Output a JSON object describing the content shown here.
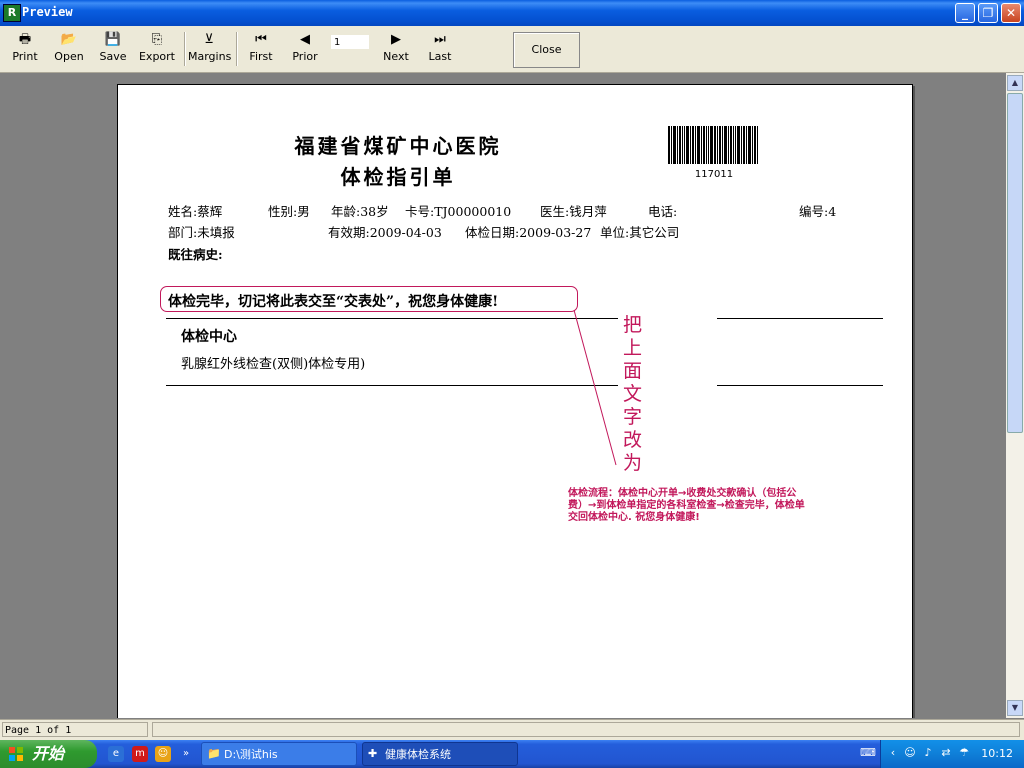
{
  "window": {
    "title": "Preview",
    "app_icon_glyph": "R",
    "buttons": {
      "minimize": "_",
      "maximize": "❐",
      "close": "✕"
    }
  },
  "toolbar": {
    "print": "Print",
    "open": "Open",
    "save": "Save",
    "export": "Export",
    "margins": "Margins",
    "first": "First",
    "prior": "Prior",
    "page_value": "1",
    "next": "Next",
    "last": "Last",
    "close": "Close"
  },
  "document": {
    "hospital": "福建省煤矿中心医院",
    "form_title": "体检指引单",
    "barcode_number": "117011",
    "line1": {
      "name": "姓名:蔡辉",
      "gender": "性别:男",
      "age": "年龄:38岁",
      "card": "卡号:TJ00000010",
      "doctor": "医生:钱月萍",
      "phone": "电话:",
      "number": "编号:4"
    },
    "line2": {
      "dept": "部门:未填报",
      "valid": "有效期:2009-04-03",
      "exam_date": "体检日期:2009-03-27",
      "unit": "单位:其它公司"
    },
    "history_label": "既往病史:",
    "note": "体检完毕，切记将此表交至“交表处”，祝您身体健康!",
    "section_title": "体检中心",
    "section_item": "乳腺红外线检查(双侧)体检专用)"
  },
  "annotations": {
    "vertical": "把上面文字改为",
    "block": "体检流程：体检中心开单→收费处交款确认（包括公费）→到体检单指定的各科室检查→检查完毕，体检单交回体检中心. 祝您身体健康!",
    "color": "#c2185b"
  },
  "statusbar": {
    "page_info": "Page 1 of 1"
  },
  "taskbar": {
    "start": "开始",
    "tasks": [
      {
        "label": "D:\\测试his"
      },
      {
        "label": "健康体检系统"
      }
    ],
    "clock": "10:12"
  },
  "colors": {
    "titlebar": "#0a5ee0",
    "taskbar": "#245edb",
    "start_button": "#2f9a2f",
    "annotation": "#c2185b"
  }
}
